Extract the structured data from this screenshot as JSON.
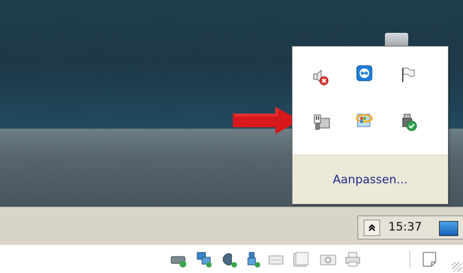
{
  "tray_popup": {
    "icons": [
      {
        "name": "volume-muted-icon"
      },
      {
        "name": "teamviewer-icon"
      },
      {
        "name": "action-center-flag-icon"
      },
      {
        "name": "network-adapter-icon"
      },
      {
        "name": "ie-update-icon"
      },
      {
        "name": "usb-safe-removal-icon"
      }
    ],
    "customize_label": "Aanpassen..."
  },
  "taskbar": {
    "clock": "15:37"
  },
  "statusbar": {
    "icons": [
      {
        "name": "hard-disk-icon"
      },
      {
        "name": "network-icon"
      },
      {
        "name": "audio-icon"
      },
      {
        "name": "usb-icon"
      },
      {
        "name": "serial-port-icon"
      },
      {
        "name": "shared-folder-icon"
      },
      {
        "name": "camera-icon"
      },
      {
        "name": "printer-icon"
      },
      {
        "name": "note-icon"
      }
    ]
  },
  "colors": {
    "arrow": "#d7191c",
    "link": "#1f2a8c",
    "popup_footer": "#ece9d8",
    "taskbar": "#d8d4c8"
  }
}
